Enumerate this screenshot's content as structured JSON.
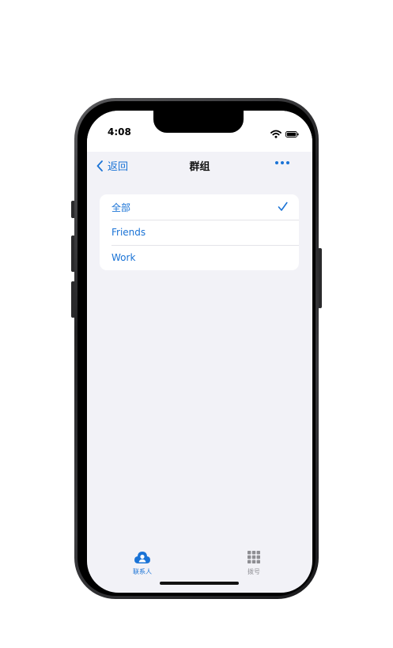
{
  "status_bar": {
    "time": "4:08"
  },
  "nav": {
    "back_label": "返回",
    "title": "群组"
  },
  "groups": {
    "items": [
      {
        "label": "全部",
        "selected": true
      },
      {
        "label": "Friends",
        "selected": false
      },
      {
        "label": "Work",
        "selected": false
      }
    ]
  },
  "tab_bar": {
    "tabs": [
      {
        "label": "联系人",
        "icon": "contacts-icon",
        "active": true
      },
      {
        "label": "拨号",
        "icon": "dialpad-icon",
        "active": false
      }
    ]
  },
  "colors": {
    "accent": "#1a73d6",
    "background": "#f2f2f7",
    "inactive": "#8e8e93"
  }
}
